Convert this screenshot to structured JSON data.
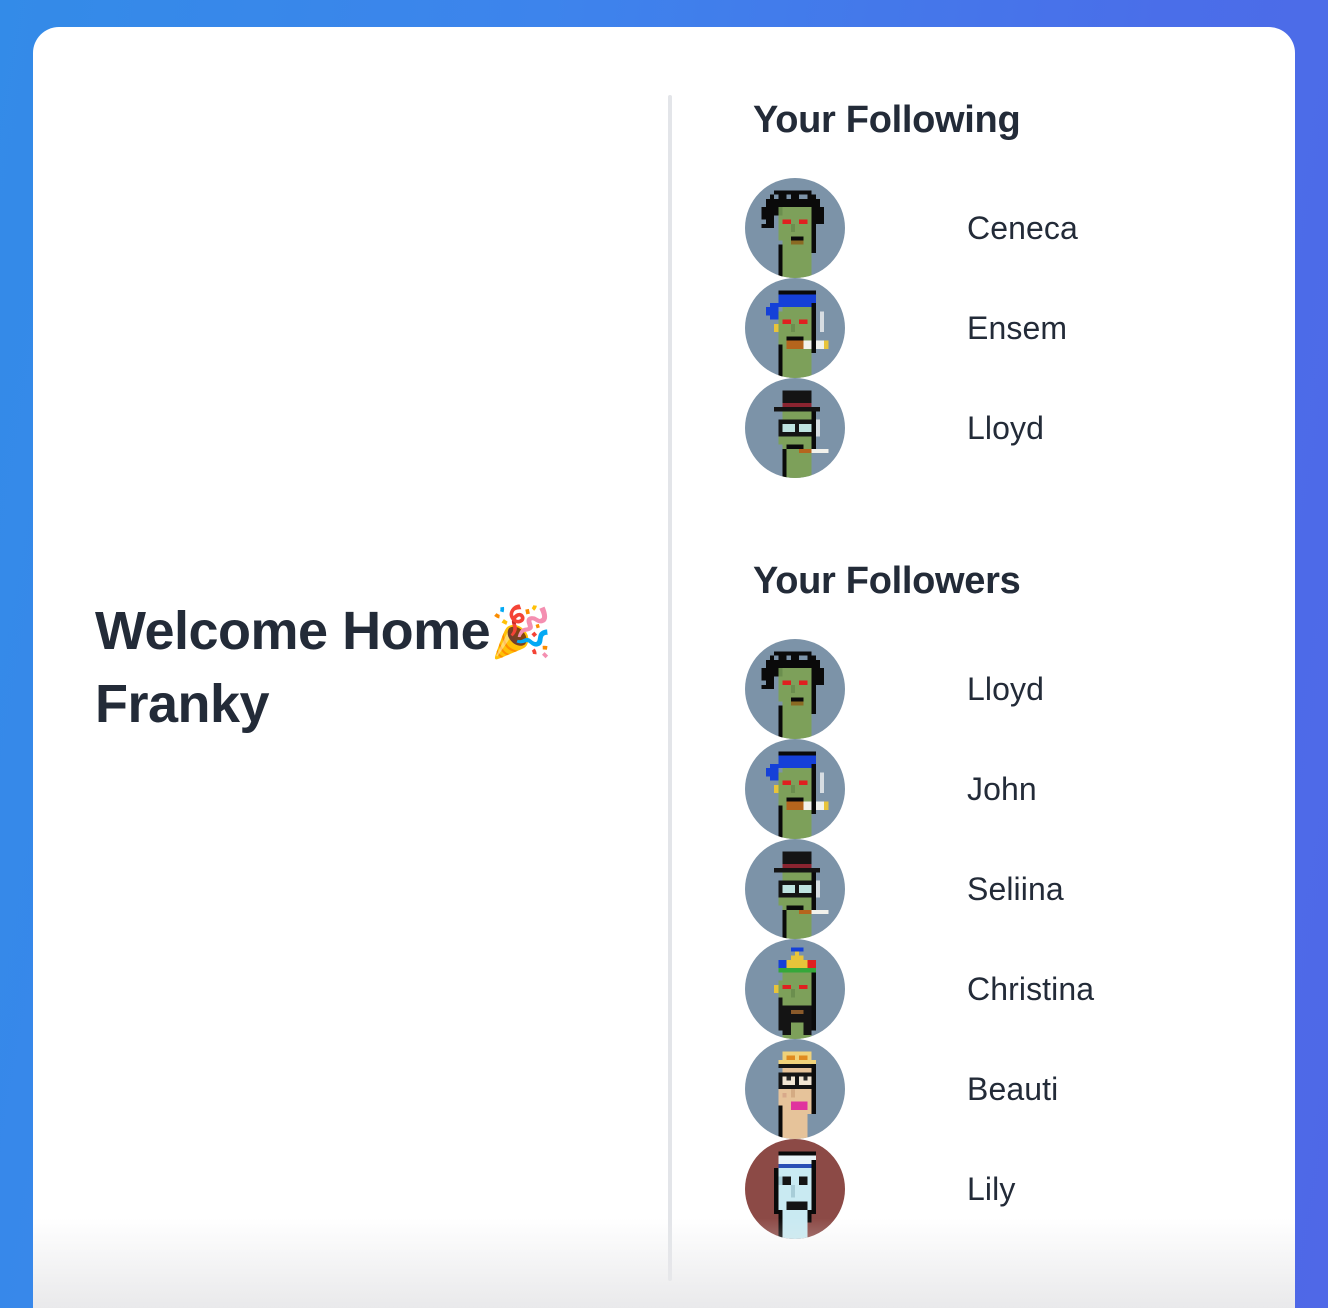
{
  "theme": {
    "bg_gradient_from": "#338be8",
    "bg_gradient_to": "#4f68e7",
    "card_bg": "#ffffff",
    "text_color": "#232b38",
    "divider_color": "#e3e5e9"
  },
  "main": {
    "welcome_text": "Welcome Home",
    "welcome_emoji": "🎉",
    "user_name": "Franky"
  },
  "following": {
    "heading": "Your Following",
    "people": [
      {
        "name": "Ceneca",
        "avatar": "punk-zombie-wild-hair"
      },
      {
        "name": "Ensem",
        "avatar": "punk-zombie-bandana-cigarette"
      },
      {
        "name": "Lloyd",
        "avatar": "punk-zombie-tophat-glasses"
      }
    ]
  },
  "followers": {
    "heading": "Your Followers",
    "people": [
      {
        "name": "Lloyd",
        "avatar": "punk-zombie-wild-hair"
      },
      {
        "name": "John",
        "avatar": "punk-zombie-bandana-cigarette"
      },
      {
        "name": "Seliina",
        "avatar": "punk-zombie-tophat-glasses"
      },
      {
        "name": "Christina",
        "avatar": "punk-zombie-rainbow-mohawk-beard"
      },
      {
        "name": "Beauti",
        "avatar": "punk-female-blonde-glasses"
      },
      {
        "name": "Lily",
        "avatar": "punk-alien-headband"
      }
    ]
  }
}
